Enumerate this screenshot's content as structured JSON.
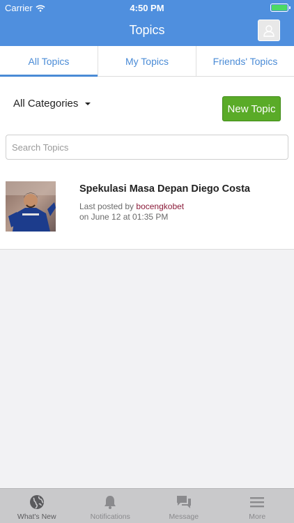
{
  "status_bar": {
    "carrier": "Carrier",
    "time": "4:50 PM",
    "battery_level": 1.0
  },
  "nav": {
    "title": "Topics"
  },
  "tabs": [
    {
      "label": "All Topics",
      "active": true
    },
    {
      "label": "My Topics",
      "active": false
    },
    {
      "label": "Friends' Topics",
      "active": false
    }
  ],
  "filters": {
    "category": "All Categories",
    "new_topic_label": "New Topic"
  },
  "search": {
    "placeholder": "Search Topics",
    "value": ""
  },
  "topics": [
    {
      "title": "Spekulasi Masa Depan Diego Costa",
      "last_posted_prefix": "Last posted by",
      "user": "bocengkobet",
      "date": "on June 12 at 01:35 PM"
    }
  ],
  "tabbar": [
    {
      "label": "What's New",
      "icon": "globe-icon",
      "active": true
    },
    {
      "label": "Notifications",
      "icon": "bell-icon",
      "active": false
    },
    {
      "label": "Message",
      "icon": "chat-icon",
      "active": false
    },
    {
      "label": "More",
      "icon": "menu-icon",
      "active": false
    }
  ],
  "colors": {
    "header": "#4f8fde",
    "tab_accent": "#4a8bd6",
    "new_topic": "#5aab28",
    "username": "#8b1c3a",
    "battery": "#4cd964"
  }
}
